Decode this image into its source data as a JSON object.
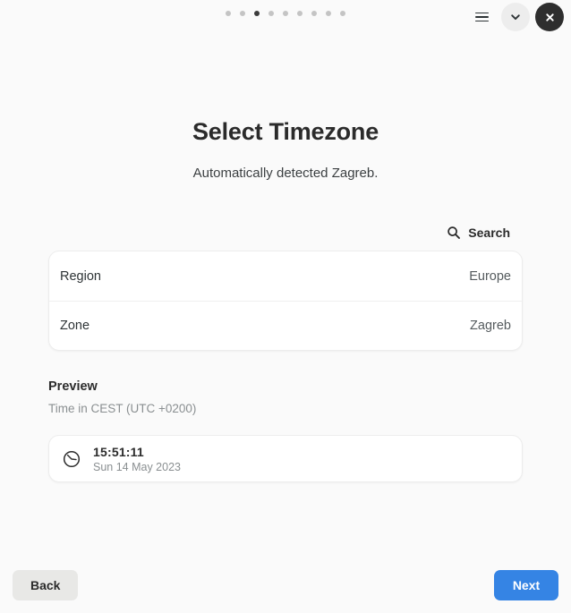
{
  "header": {
    "progress": {
      "total_steps": 9,
      "current_step": 3
    },
    "menu_icon": "hamburger-menu-icon",
    "dropdown_icon": "chevron-down-icon",
    "close_icon": "close-icon"
  },
  "main": {
    "title": "Select Timezone",
    "subtitle": "Automatically detected Zagreb.",
    "search": {
      "label": "Search",
      "icon": "search-icon"
    },
    "rows": [
      {
        "label": "Region",
        "value": "Europe"
      },
      {
        "label": "Zone",
        "value": "Zagreb"
      }
    ],
    "preview": {
      "title": "Preview",
      "subtitle": "Time in CEST (UTC +0200)",
      "icon": "clock-icon",
      "time": "15:51:11",
      "date": "Sun 14 May 2023"
    }
  },
  "footer": {
    "back_label": "Back",
    "next_label": "Next"
  },
  "colors": {
    "accent": "#3584e4",
    "page_background": "#fafafa",
    "card_background": "#ffffff",
    "close_button": "#2e2e2e",
    "dot_active": "#3b3b3b",
    "dot_inactive": "#c4c4c4"
  }
}
